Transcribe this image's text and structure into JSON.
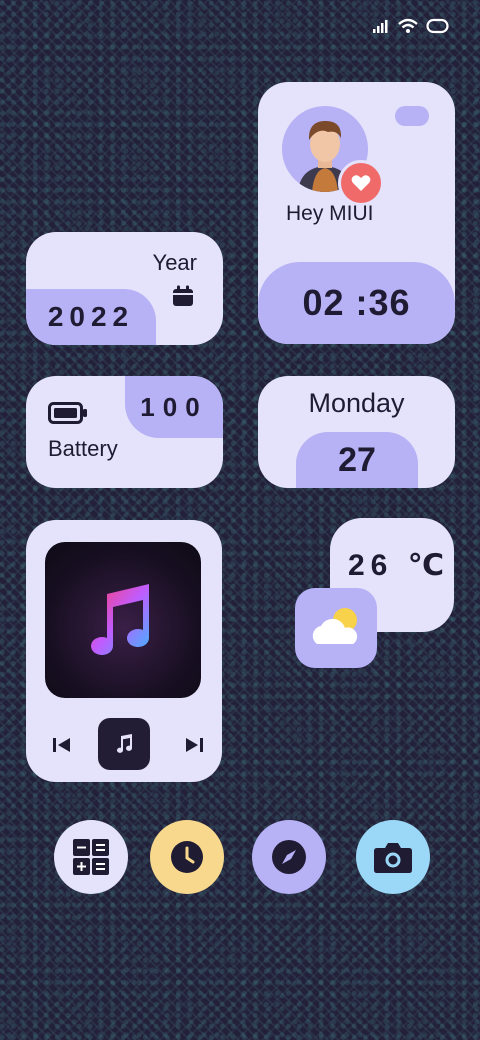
{
  "status_bar": {
    "signal_icon": "signal-bars-icon",
    "wifi_icon": "wifi-icon",
    "battery_icon": "battery-outline-icon"
  },
  "year_widget": {
    "label": "Year",
    "value": "2022",
    "icon": "calendar-icon"
  },
  "profile_widget": {
    "greeting": "Hey MIUI",
    "avatar_icon": "user-avatar-icon",
    "badge_icon": "heart-icon",
    "time": "02 :36"
  },
  "battery_widget": {
    "value": "100",
    "label": "Battery",
    "icon": "battery-icon"
  },
  "date_widget": {
    "weekday": "Monday",
    "day": "27"
  },
  "music_widget": {
    "art_icon": "music-note-icon",
    "prev_icon": "previous-track-icon",
    "music_icon": "music-icon",
    "next_icon": "next-track-icon"
  },
  "weather_widget": {
    "temperature": "26 ℃",
    "icon": "partly-cloudy-icon"
  },
  "dock": [
    {
      "name": "calculator-icon",
      "color": "#e5e3fb"
    },
    {
      "name": "clock-icon",
      "color": "#f8d88d"
    },
    {
      "name": "compass-icon",
      "color": "#b7b1f6"
    },
    {
      "name": "camera-icon",
      "color": "#9bd8f7"
    }
  ],
  "colors": {
    "card": "#e5e3fb",
    "accent": "#b7b1f6",
    "heart": "#f06a6a"
  }
}
